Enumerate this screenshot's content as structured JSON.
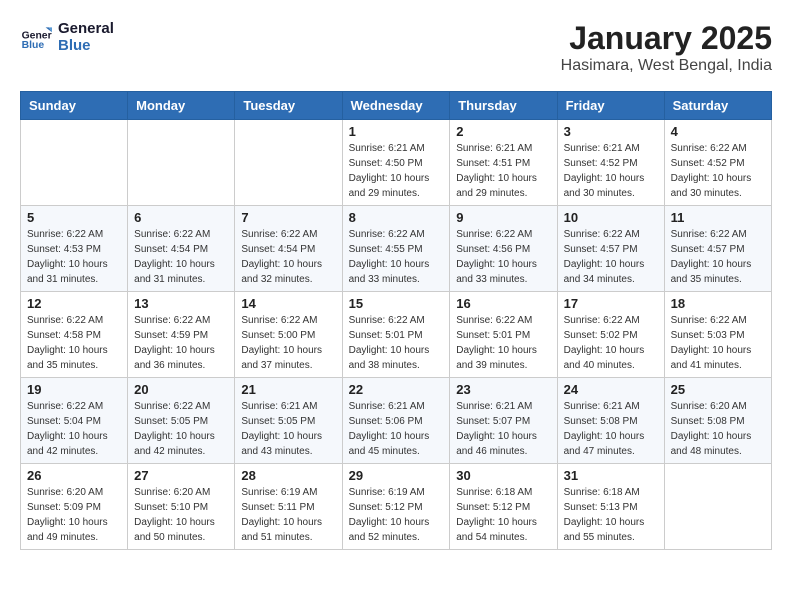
{
  "header": {
    "logo_line1": "General",
    "logo_line2": "Blue",
    "title": "January 2025",
    "subtitle": "Hasimara, West Bengal, India"
  },
  "days_of_week": [
    "Sunday",
    "Monday",
    "Tuesday",
    "Wednesday",
    "Thursday",
    "Friday",
    "Saturday"
  ],
  "weeks": [
    [
      {
        "day": "",
        "info": ""
      },
      {
        "day": "",
        "info": ""
      },
      {
        "day": "",
        "info": ""
      },
      {
        "day": "1",
        "info": "Sunrise: 6:21 AM\nSunset: 4:50 PM\nDaylight: 10 hours\nand 29 minutes."
      },
      {
        "day": "2",
        "info": "Sunrise: 6:21 AM\nSunset: 4:51 PM\nDaylight: 10 hours\nand 29 minutes."
      },
      {
        "day": "3",
        "info": "Sunrise: 6:21 AM\nSunset: 4:52 PM\nDaylight: 10 hours\nand 30 minutes."
      },
      {
        "day": "4",
        "info": "Sunrise: 6:22 AM\nSunset: 4:52 PM\nDaylight: 10 hours\nand 30 minutes."
      }
    ],
    [
      {
        "day": "5",
        "info": "Sunrise: 6:22 AM\nSunset: 4:53 PM\nDaylight: 10 hours\nand 31 minutes."
      },
      {
        "day": "6",
        "info": "Sunrise: 6:22 AM\nSunset: 4:54 PM\nDaylight: 10 hours\nand 31 minutes."
      },
      {
        "day": "7",
        "info": "Sunrise: 6:22 AM\nSunset: 4:54 PM\nDaylight: 10 hours\nand 32 minutes."
      },
      {
        "day": "8",
        "info": "Sunrise: 6:22 AM\nSunset: 4:55 PM\nDaylight: 10 hours\nand 33 minutes."
      },
      {
        "day": "9",
        "info": "Sunrise: 6:22 AM\nSunset: 4:56 PM\nDaylight: 10 hours\nand 33 minutes."
      },
      {
        "day": "10",
        "info": "Sunrise: 6:22 AM\nSunset: 4:57 PM\nDaylight: 10 hours\nand 34 minutes."
      },
      {
        "day": "11",
        "info": "Sunrise: 6:22 AM\nSunset: 4:57 PM\nDaylight: 10 hours\nand 35 minutes."
      }
    ],
    [
      {
        "day": "12",
        "info": "Sunrise: 6:22 AM\nSunset: 4:58 PM\nDaylight: 10 hours\nand 35 minutes."
      },
      {
        "day": "13",
        "info": "Sunrise: 6:22 AM\nSunset: 4:59 PM\nDaylight: 10 hours\nand 36 minutes."
      },
      {
        "day": "14",
        "info": "Sunrise: 6:22 AM\nSunset: 5:00 PM\nDaylight: 10 hours\nand 37 minutes."
      },
      {
        "day": "15",
        "info": "Sunrise: 6:22 AM\nSunset: 5:01 PM\nDaylight: 10 hours\nand 38 minutes."
      },
      {
        "day": "16",
        "info": "Sunrise: 6:22 AM\nSunset: 5:01 PM\nDaylight: 10 hours\nand 39 minutes."
      },
      {
        "day": "17",
        "info": "Sunrise: 6:22 AM\nSunset: 5:02 PM\nDaylight: 10 hours\nand 40 minutes."
      },
      {
        "day": "18",
        "info": "Sunrise: 6:22 AM\nSunset: 5:03 PM\nDaylight: 10 hours\nand 41 minutes."
      }
    ],
    [
      {
        "day": "19",
        "info": "Sunrise: 6:22 AM\nSunset: 5:04 PM\nDaylight: 10 hours\nand 42 minutes."
      },
      {
        "day": "20",
        "info": "Sunrise: 6:22 AM\nSunset: 5:05 PM\nDaylight: 10 hours\nand 42 minutes."
      },
      {
        "day": "21",
        "info": "Sunrise: 6:21 AM\nSunset: 5:05 PM\nDaylight: 10 hours\nand 43 minutes."
      },
      {
        "day": "22",
        "info": "Sunrise: 6:21 AM\nSunset: 5:06 PM\nDaylight: 10 hours\nand 45 minutes."
      },
      {
        "day": "23",
        "info": "Sunrise: 6:21 AM\nSunset: 5:07 PM\nDaylight: 10 hours\nand 46 minutes."
      },
      {
        "day": "24",
        "info": "Sunrise: 6:21 AM\nSunset: 5:08 PM\nDaylight: 10 hours\nand 47 minutes."
      },
      {
        "day": "25",
        "info": "Sunrise: 6:20 AM\nSunset: 5:08 PM\nDaylight: 10 hours\nand 48 minutes."
      }
    ],
    [
      {
        "day": "26",
        "info": "Sunrise: 6:20 AM\nSunset: 5:09 PM\nDaylight: 10 hours\nand 49 minutes."
      },
      {
        "day": "27",
        "info": "Sunrise: 6:20 AM\nSunset: 5:10 PM\nDaylight: 10 hours\nand 50 minutes."
      },
      {
        "day": "28",
        "info": "Sunrise: 6:19 AM\nSunset: 5:11 PM\nDaylight: 10 hours\nand 51 minutes."
      },
      {
        "day": "29",
        "info": "Sunrise: 6:19 AM\nSunset: 5:12 PM\nDaylight: 10 hours\nand 52 minutes."
      },
      {
        "day": "30",
        "info": "Sunrise: 6:18 AM\nSunset: 5:12 PM\nDaylight: 10 hours\nand 54 minutes."
      },
      {
        "day": "31",
        "info": "Sunrise: 6:18 AM\nSunset: 5:13 PM\nDaylight: 10 hours\nand 55 minutes."
      },
      {
        "day": "",
        "info": ""
      }
    ]
  ]
}
